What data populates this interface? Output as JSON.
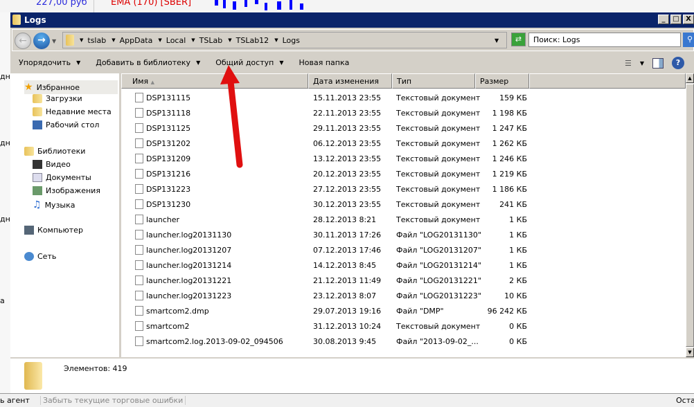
{
  "background": {
    "price": "227,00 руб",
    "indicator": "EMA (170) [SBER]",
    "left_labels": [
      "дн",
      "дн",
      "дн",
      "а"
    ],
    "bottom_left": "ь агент",
    "bottom_middle": "Забыть текущие торговые  ошибки",
    "bottom_right": "Оста"
  },
  "window": {
    "title": "Logs",
    "min": "_",
    "max": "□",
    "close": "X"
  },
  "address": {
    "crumbs": [
      "tslab",
      "AppData",
      "Local",
      "TSLab",
      "TSLab12",
      "Logs"
    ],
    "search_placeholder": "Поиск: Logs"
  },
  "toolbar": {
    "organize": "Упорядочить",
    "add_library": "Добавить в библиотеку",
    "share": "Общий доступ",
    "new_folder": "Новая папка"
  },
  "nav": {
    "favorites": "Избранное",
    "downloads": "Загрузки",
    "recent": "Недавние места",
    "desktop": "Рабочий стол",
    "libraries": "Библиотеки",
    "video": "Видео",
    "documents": "Документы",
    "images": "Изображения",
    "music": "Музыка",
    "computer": "Компьютер",
    "network": "Сеть"
  },
  "columns": {
    "name": "Имя",
    "date": "Дата изменения",
    "type": "Тип",
    "size": "Размер"
  },
  "files": [
    {
      "name": "DSP131115",
      "date": "15.11.2013 23:55",
      "type": "Текстовый документ",
      "size": "159 КБ"
    },
    {
      "name": "DSP131118",
      "date": "22.11.2013 23:55",
      "type": "Текстовый документ",
      "size": "1 198 КБ"
    },
    {
      "name": "DSP131125",
      "date": "29.11.2013 23:55",
      "type": "Текстовый документ",
      "size": "1 247 КБ"
    },
    {
      "name": "DSP131202",
      "date": "06.12.2013 23:55",
      "type": "Текстовый документ",
      "size": "1 262 КБ"
    },
    {
      "name": "DSP131209",
      "date": "13.12.2013 23:55",
      "type": "Текстовый документ",
      "size": "1 246 КБ"
    },
    {
      "name": "DSP131216",
      "date": "20.12.2013 23:55",
      "type": "Текстовый документ",
      "size": "1 219 КБ"
    },
    {
      "name": "DSP131223",
      "date": "27.12.2013 23:55",
      "type": "Текстовый документ",
      "size": "1 186 КБ"
    },
    {
      "name": "DSP131230",
      "date": "30.12.2013 23:55",
      "type": "Текстовый документ",
      "size": "241 КБ"
    },
    {
      "name": "launcher",
      "date": "28.12.2013 8:21",
      "type": "Текстовый документ",
      "size": "1 КБ"
    },
    {
      "name": "launcher.log20131130",
      "date": "30.11.2013 17:26",
      "type": "Файл \"LOG20131130\"",
      "size": "1 КБ"
    },
    {
      "name": "launcher.log20131207",
      "date": "07.12.2013 17:46",
      "type": "Файл \"LOG20131207\"",
      "size": "1 КБ"
    },
    {
      "name": "launcher.log20131214",
      "date": "14.12.2013 8:45",
      "type": "Файл \"LOG20131214\"",
      "size": "1 КБ"
    },
    {
      "name": "launcher.log20131221",
      "date": "21.12.2013 11:49",
      "type": "Файл \"LOG20131221\"",
      "size": "2 КБ"
    },
    {
      "name": "launcher.log20131223",
      "date": "23.12.2013 8:07",
      "type": "Файл \"LOG20131223\"",
      "size": "10 КБ"
    },
    {
      "name": "smartcom2.dmp",
      "date": "29.07.2013 19:16",
      "type": "Файл \"DMP\"",
      "size": "96 242 КБ"
    },
    {
      "name": "smartcom2",
      "date": "31.12.2013 10:24",
      "type": "Текстовый документ",
      "size": "0 КБ"
    },
    {
      "name": "smartcom2.log.2013-09-02_094506",
      "date": "30.08.2013 9:45",
      "type": "Файл \"2013-09-02_...",
      "size": "0 КБ"
    }
  ],
  "status": {
    "items": "Элементов: 419"
  },
  "colors": {
    "titlebar": "#0a246a",
    "annotation_arrow": "#e01010"
  }
}
